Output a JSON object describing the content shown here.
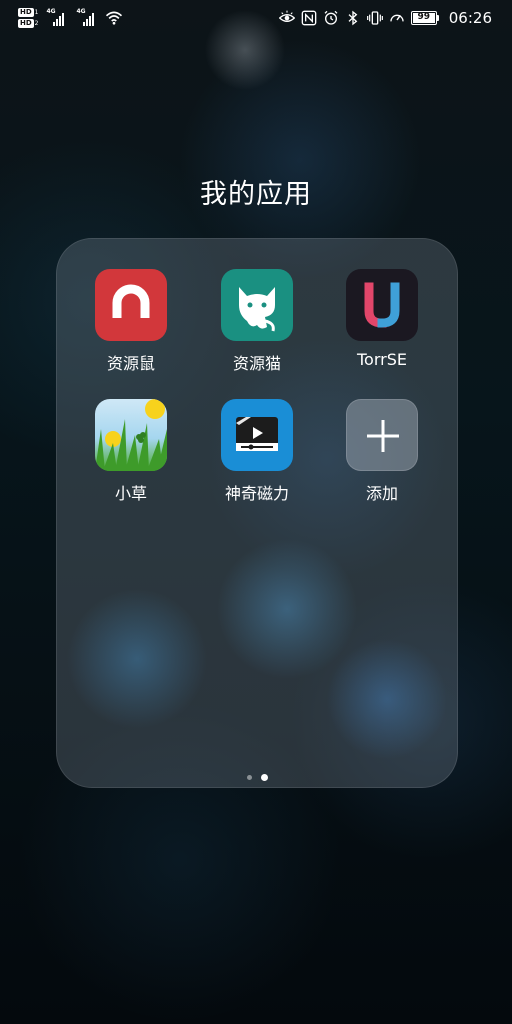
{
  "status_bar": {
    "sim1": {
      "badge": "HD",
      "num": "1"
    },
    "sim2": {
      "badge": "HD",
      "num": "2"
    },
    "signal1": {
      "gen": "4G"
    },
    "signal2": {
      "gen": "4G"
    },
    "icons": [
      "wifi-icon",
      "eye-comfort-icon",
      "nfc-icon",
      "alarm-icon",
      "bluetooth-icon",
      "vibrate-icon",
      "speedometer-icon"
    ],
    "battery": "99",
    "battery_level": 0.99,
    "time": "06:26"
  },
  "folder": {
    "title": "我的应用",
    "apps": [
      {
        "label": "资源鼠",
        "icon": "magnet-icon",
        "color": "#d2373b"
      },
      {
        "label": "资源猫",
        "icon": "cat-icon",
        "color": "#1a9081"
      },
      {
        "label": "TorrSE",
        "icon": "u-logo-icon",
        "color": "#1b1821"
      },
      {
        "label": "小草",
        "icon": "grass-flower-icon",
        "color": "#a5d6ef"
      },
      {
        "label": "神奇磁力",
        "icon": "video-player-icon",
        "color": "#1a8ed6"
      },
      {
        "label": "添加",
        "icon": "plus-icon",
        "color": "#9aa4ad"
      }
    ],
    "pages": {
      "total": 2,
      "current": 2
    }
  }
}
